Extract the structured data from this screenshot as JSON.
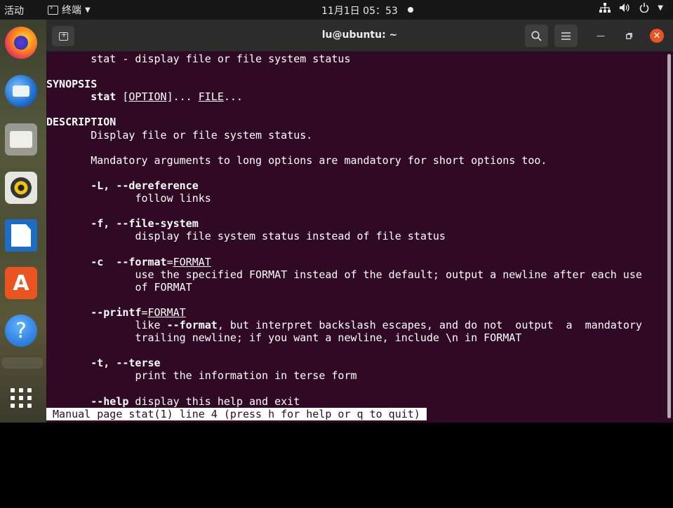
{
  "topbar": {
    "activities": "活动",
    "app_name": "终端",
    "clock": "11月1日  05：53",
    "icons": [
      "network-icon",
      "volume-icon",
      "power-icon",
      "chevron-down-icon"
    ]
  },
  "dock": {
    "items": [
      {
        "name": "firefox",
        "icon": "firefox-icon"
      },
      {
        "name": "thunderbird",
        "icon": "thunderbird-icon"
      },
      {
        "name": "files",
        "icon": "files-icon"
      },
      {
        "name": "rhythmbox",
        "icon": "rhythmbox-icon"
      },
      {
        "name": "libreoffice-writer",
        "icon": "writer-icon"
      },
      {
        "name": "ubuntu-software",
        "icon": "software-store-icon",
        "glyph": "A"
      },
      {
        "name": "help",
        "icon": "help-icon",
        "glyph": "?"
      },
      {
        "name": "show-applications",
        "icon": "app-grid-icon"
      }
    ]
  },
  "window": {
    "title": "lu@ubuntu: ~",
    "accent": "#e95420",
    "background": "#300a24"
  },
  "manpage": {
    "name_line": "stat - display file or file system status",
    "synopsis_heading": "SYNOPSIS",
    "synopsis_cmd": "stat",
    "synopsis_option": "OPTION",
    "synopsis_file": "FILE",
    "description_heading": "DESCRIPTION",
    "desc1": "Display file or file system status.",
    "desc2": "Mandatory arguments to long options are mandatory for short options too.",
    "opt_L": "-L, --dereference",
    "opt_L_desc": "follow links",
    "opt_f": "-f, --file-system",
    "opt_f_desc": "display file system status instead of file status",
    "opt_c": "-c  --format",
    "opt_c_arg": "FORMAT",
    "opt_c_desc1": "use the specified FORMAT instead of the default; output a newline after each use",
    "opt_c_desc2": "of FORMAT",
    "opt_printf": "--printf",
    "opt_printf_arg": "FORMAT",
    "opt_printf_desc1a": "like ",
    "opt_printf_desc1b": "--format",
    "opt_printf_desc1c": ", but interpret backslash escapes, and do not  output  a  mandatory",
    "opt_printf_desc2": "trailing newline; if you want a newline, include \\n in FORMAT",
    "opt_t": "-t, --terse",
    "opt_t_desc": "print the information in terse form",
    "opt_help": "--help",
    "opt_help_desc": " display this help and exit",
    "status_line": " Manual page stat(1) line 4 (press h for help or q to quit) "
  }
}
